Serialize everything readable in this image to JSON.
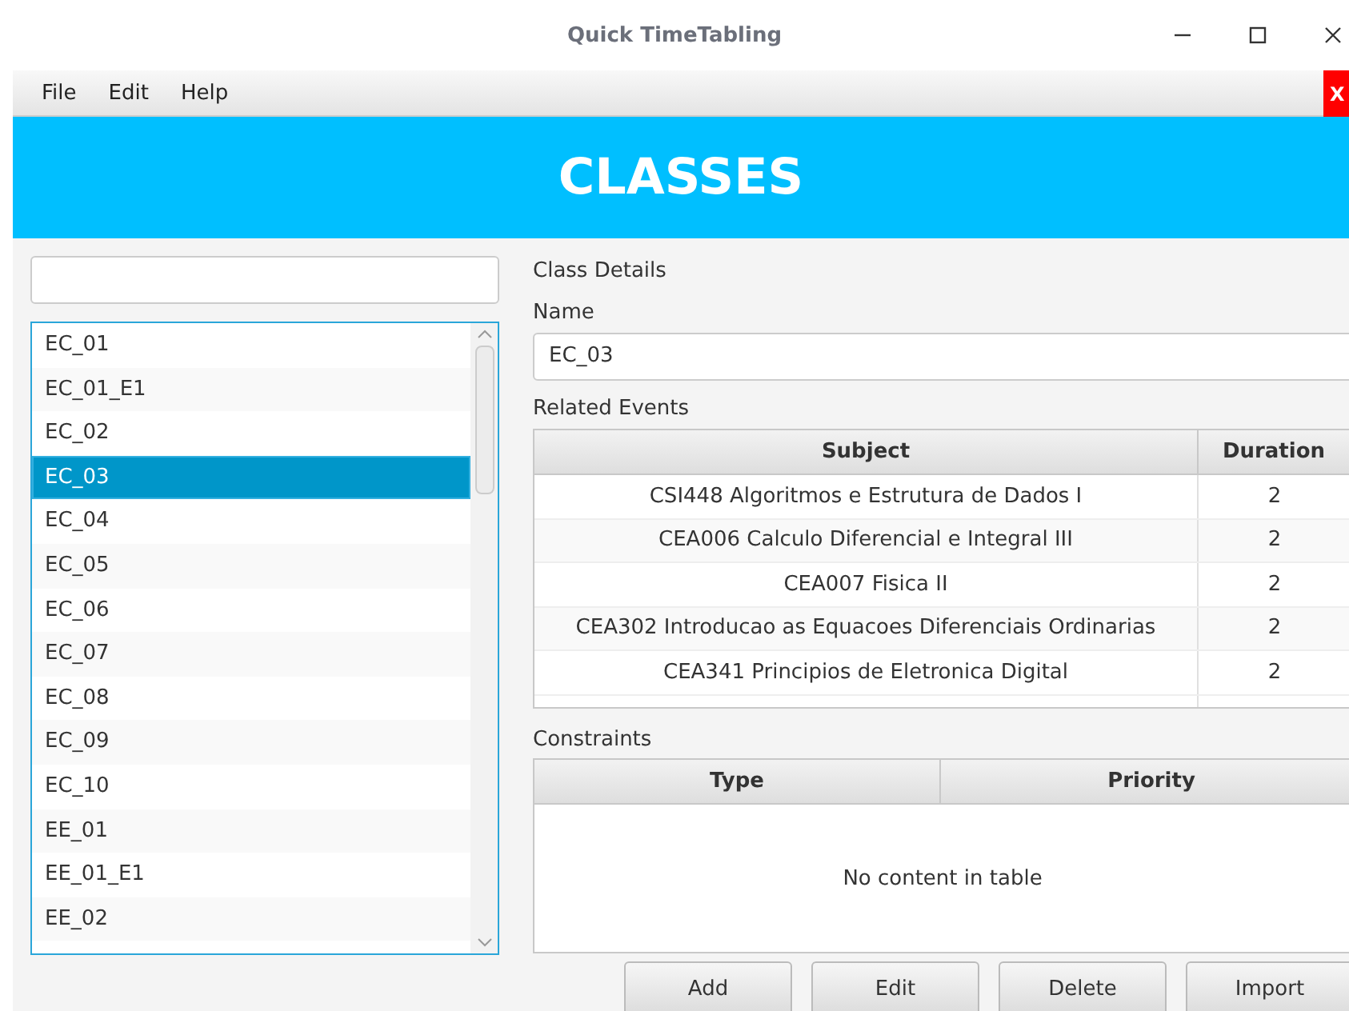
{
  "window": {
    "title": "Quick TimeTabling"
  },
  "menu": [
    "File",
    "Edit",
    "Help"
  ],
  "close_badge": "X",
  "banner": "CLASSES",
  "class_list": [
    {
      "label": "EC_01",
      "selected": false
    },
    {
      "label": "EC_01_E1",
      "selected": false
    },
    {
      "label": "EC_02",
      "selected": false
    },
    {
      "label": "EC_03",
      "selected": true
    },
    {
      "label": "EC_04",
      "selected": false
    },
    {
      "label": "EC_05",
      "selected": false
    },
    {
      "label": "EC_06",
      "selected": false
    },
    {
      "label": "EC_07",
      "selected": false
    },
    {
      "label": "EC_08",
      "selected": false
    },
    {
      "label": "EC_09",
      "selected": false
    },
    {
      "label": "EC_10",
      "selected": false
    },
    {
      "label": "EE_01",
      "selected": false
    },
    {
      "label": "EE_01_E1",
      "selected": false
    },
    {
      "label": "EE_02",
      "selected": false
    }
  ],
  "details": {
    "title": "Class Details",
    "name_label": "Name",
    "name_value": "EC_03",
    "events_label": "Related Events",
    "events_columns": [
      "Subject",
      "Duration"
    ],
    "events_rows": [
      {
        "subject": "CSI448 Algoritmos e Estrutura de Dados I",
        "duration": "2"
      },
      {
        "subject": "CEA006 Calculo Diferencial e Integral III",
        "duration": "2"
      },
      {
        "subject": "CEA007 Fisica II",
        "duration": "2"
      },
      {
        "subject": "CEA302 Introducao as Equacoes Diferenciais Ordinarias",
        "duration": "2"
      },
      {
        "subject": "CEA341 Principios de Eletronica Digital",
        "duration": "2"
      }
    ],
    "constraints_label": "Constraints",
    "constraints_columns": [
      "Type",
      "Priority"
    ],
    "constraints_empty": "No content in table"
  },
  "buttons": [
    "Add",
    "Edit",
    "Delete",
    "Import"
  ]
}
